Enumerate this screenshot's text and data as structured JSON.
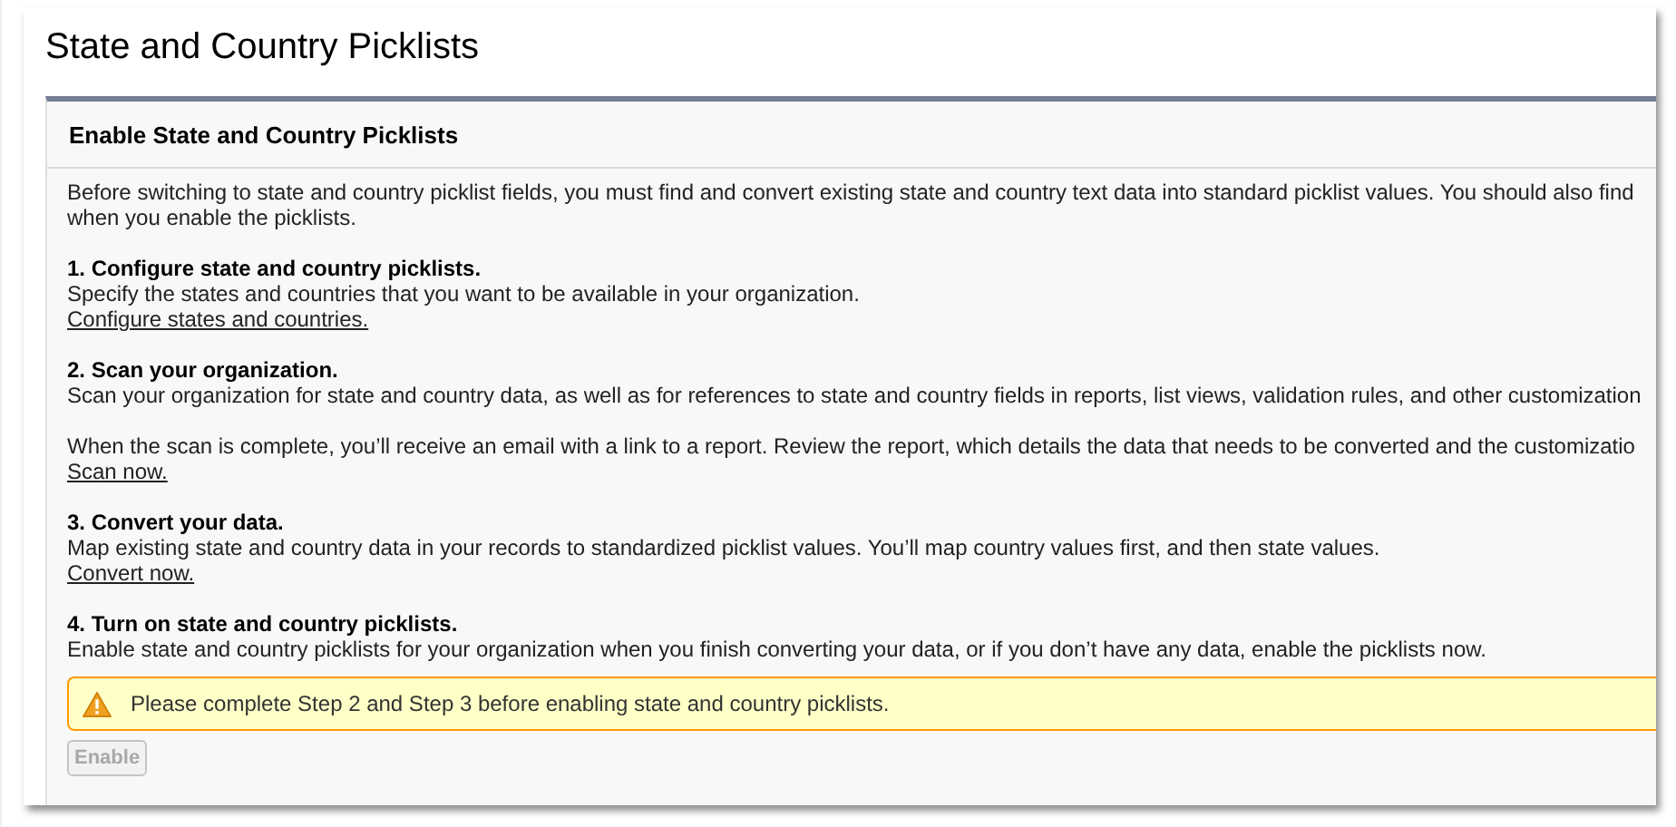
{
  "page_title": "State and Country Picklists",
  "panel": {
    "heading": "Enable State and Country Picklists",
    "intro_lines": [
      "Before switching to state and country picklist fields, you must find and convert existing state and country text data into standard picklist values. You should also find",
      "when you enable the picklists."
    ],
    "steps": [
      {
        "heading": "1. Configure state and country picklists.",
        "paragraphs": [
          "Specify the states and countries that you want to be available in your organization."
        ],
        "link": "Configure states and countries."
      },
      {
        "heading": "2. Scan your organization.",
        "paragraphs": [
          "Scan your organization for state and country data, as well as for references to state and country fields in reports, list views, validation rules, and other customization",
          "When the scan is complete, you’ll receive an email with a link to a report. Review the report, which details the data that needs to be converted and the customizatio"
        ],
        "link": "Scan now."
      },
      {
        "heading": "3. Convert your data.",
        "paragraphs": [
          "Map existing state and country data in your records to standardized picklist values. You’ll map country values first, and then state values."
        ],
        "link": "Convert now."
      },
      {
        "heading": "4. Turn on state and country picklists.",
        "paragraphs": [
          "Enable state and country picklists for your organization when you finish converting your data, or if you don’t have any data, enable the picklists now."
        ]
      }
    ],
    "warning": "Please complete Step 2 and Step 3 before enabling state and country picklists.",
    "button": {
      "label": "Enable",
      "disabled": true
    }
  }
}
